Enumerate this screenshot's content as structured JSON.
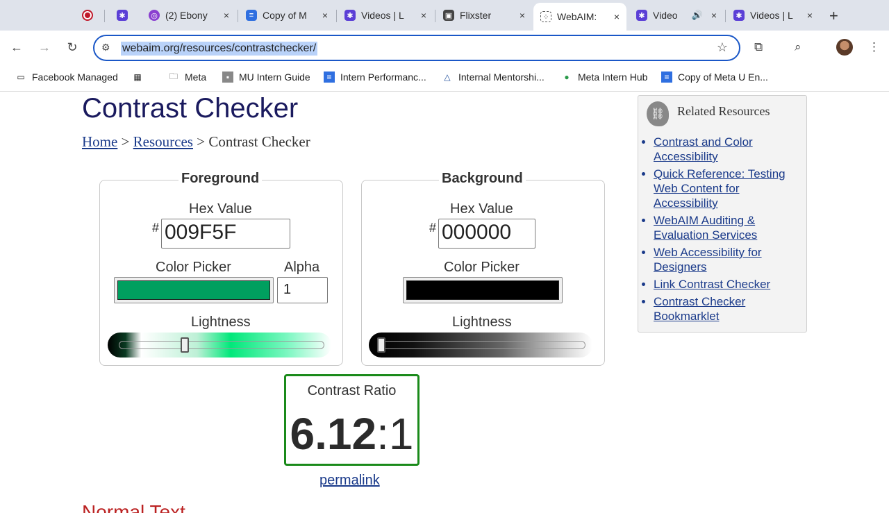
{
  "tabs": [
    {
      "title": "",
      "close": ""
    },
    {
      "title": "",
      "close": ""
    },
    {
      "title": "(2) Ebony",
      "close": "×"
    },
    {
      "title": "Copy of M",
      "close": "×"
    },
    {
      "title": "Videos | L",
      "close": "×"
    },
    {
      "title": "Flixster",
      "close": "×"
    },
    {
      "title": "WebAIM:",
      "close": "×"
    },
    {
      "title": "Video",
      "close": ""
    },
    {
      "title": "Videos | L",
      "close": "×"
    }
  ],
  "toolbar": {
    "back": "←",
    "forward": "→",
    "reload": "↻",
    "url": "webaim.org/resources/contrastchecker/",
    "new_tab": "+"
  },
  "bookmarks": [
    "Facebook Managed",
    "",
    "Meta",
    "MU Intern Guide",
    "Intern Performanc...",
    "Internal Mentorshi...",
    "Meta Intern Hub",
    "Copy of Meta U En..."
  ],
  "page": {
    "title": "Contrast Checker",
    "breadcrumb": {
      "home": "Home",
      "sep1": ">",
      "resources": "Resources",
      "sep2": ">",
      "current": "Contrast Checker"
    },
    "foreground": {
      "legend": "Foreground",
      "hex_label": "Hex Value",
      "hash": "#",
      "hex_value": "009F5F",
      "picker_label": "Color Picker",
      "alpha_label": "Alpha",
      "alpha_value": "1",
      "lightness_label": "Lightness",
      "lightness_level": 0.32,
      "color": "#009F5F"
    },
    "background": {
      "legend": "Background",
      "hex_label": "Hex Value",
      "hash": "#",
      "hex_value": "000000",
      "picker_label": "Color Picker",
      "lightness_label": "Lightness",
      "lightness_level": 0.0,
      "color": "#000000"
    },
    "contrast": {
      "label": "Contrast Ratio",
      "value": "6.12",
      "colon": ":",
      "suffix": "1",
      "border_color": "#1a8a1a"
    },
    "permalink": "permalink",
    "next_heading": "Normal Text"
  },
  "related": {
    "title": "Related Resources",
    "links": [
      "Contrast and Color Accessibility",
      "Quick Reference: Testing Web Content for Accessibility",
      "WebAIM Auditing & Evaluation Services",
      "Web Accessibility for Designers",
      "Link Contrast Checker",
      "Contrast Checker Bookmarklet"
    ]
  }
}
